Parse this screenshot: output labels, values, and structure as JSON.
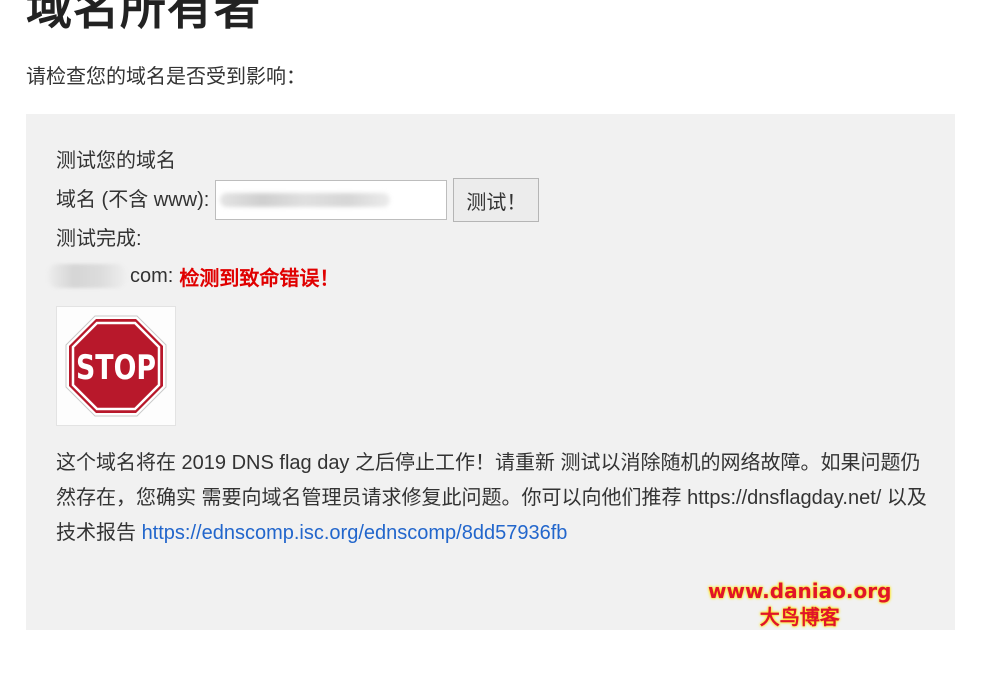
{
  "page": {
    "title": "域名所有者",
    "intro": "请检查您的域名是否受到影响："
  },
  "test": {
    "heading": "测试您的域名",
    "domain_label": "域名 (不含 www):",
    "domain_value": "",
    "button_label": "测试！",
    "complete_label": "测试完成:",
    "result_suffix": "com:",
    "result_status": "检测到致命错误！",
    "stop_sign_text": "STOP"
  },
  "message": {
    "text_1": "这个域名将在 2019 DNS flag day 之后停止工作！请重新 测试以消除随机的网络故障。如果问题仍然存在，您确实 需要向域名管理员请求修复此问题。你可以向他们推荐 https://dnsflagday.net/ 以及",
    "text_2": "技术报告",
    "report_link": "https://ednscomp.isc.org/ednscomp/8dd57936fb"
  },
  "watermark": {
    "url": "www.daniao.org",
    "name": "大鸟博客"
  },
  "colors": {
    "panel_bg": "#f1f1f1",
    "error": "#e00000",
    "link": "#2266cc",
    "stop_red": "#b8182b"
  },
  "icons": {
    "stop": "stop-sign-icon"
  }
}
